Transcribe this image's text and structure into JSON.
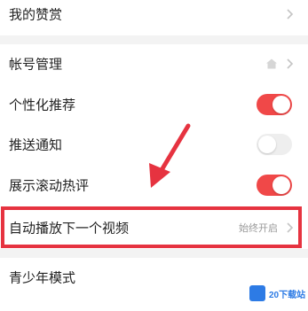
{
  "settings": {
    "my_reward": {
      "label": "我的赞赏"
    },
    "account": {
      "label": "帐号管理",
      "icon": "home-icon"
    },
    "personalized": {
      "label": "个性化推荐",
      "enabled": true
    },
    "push": {
      "label": "推送通知",
      "enabled": false
    },
    "scroll_hot_comments": {
      "label": "展示滚动热评",
      "enabled": true
    },
    "autoplay_next": {
      "label": "自动播放下一个视频",
      "value": "始终开启"
    },
    "teen_mode": {
      "label": "青少年模式"
    }
  },
  "colors": {
    "toggle_on": "#f04848",
    "toggle_off": "#eeeeee",
    "highlight": "#e63340",
    "section_gap": "#f3f3f3"
  },
  "watermark": {
    "text": "20下载站"
  }
}
